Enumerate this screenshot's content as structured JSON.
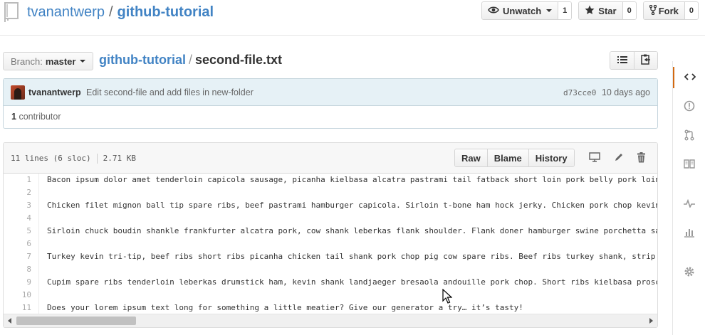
{
  "repo": {
    "owner": "tvanantwerp",
    "separator": "/",
    "name": "github-tutorial"
  },
  "actions": {
    "watch": {
      "label": "Unwatch",
      "count": "1"
    },
    "star": {
      "label": "Star",
      "count": "0"
    },
    "fork": {
      "label": "Fork",
      "count": "0"
    }
  },
  "branch": {
    "label": "Branch:",
    "value": "master"
  },
  "breadcrumb": {
    "root": "github-tutorial",
    "separator": "/",
    "file": "second-file.txt"
  },
  "commit": {
    "author": "tvanantwerp",
    "message": "Edit second-file and add files in new-folder",
    "sha": "d73cce0",
    "age": "10 days ago"
  },
  "contributors": {
    "count": "1",
    "label": "contributor"
  },
  "file": {
    "lines_info": "11 lines (6 sloc)",
    "size": "2.71 KB",
    "buttons": {
      "raw": "Raw",
      "blame": "Blame",
      "history": "History"
    }
  },
  "code_lines": [
    {
      "n": "1",
      "text": "Bacon ipsum dolor amet tenderloin capicola sausage, picanha kielbasa alcatra pastrami tail fatback short loin pork belly pork loin"
    },
    {
      "n": "2",
      "text": ""
    },
    {
      "n": "3",
      "text": "Chicken filet mignon ball tip spare ribs, beef pastrami hamburger capicola. Sirloin t-bone ham hock jerky. Chicken pork chop kevin"
    },
    {
      "n": "4",
      "text": ""
    },
    {
      "n": "5",
      "text": "Sirloin chuck boudin shankle frankfurter alcatra pork, cow shank leberkas flank shoulder. Flank doner hamburger swine porchetta sa"
    },
    {
      "n": "6",
      "text": ""
    },
    {
      "n": "7",
      "text": "Turkey kevin tri-tip, beef ribs short ribs picanha chicken tail shank pork chop pig cow spare ribs. Beef ribs turkey shank, strip"
    },
    {
      "n": "8",
      "text": ""
    },
    {
      "n": "9",
      "text": "Cupim spare ribs tenderloin leberkas drumstick ham, kevin shank landjaeger bresaola andouille pork chop. Short ribs kielbasa prosc"
    },
    {
      "n": "10",
      "text": ""
    },
    {
      "n": "11",
      "text": "Does your lorem ipsum text long for something a little meatier? Give our generator a try… it’s tasty!"
    }
  ],
  "sidebar_icons": [
    "code-icon",
    "issues-icon",
    "pull-requests-icon",
    "wiki-icon",
    "pulse-icon",
    "graphs-icon",
    "settings-icon"
  ],
  "colors": {
    "link": "#4183c4",
    "commit_bg": "#e6f1f6",
    "accent": "#d26911"
  }
}
